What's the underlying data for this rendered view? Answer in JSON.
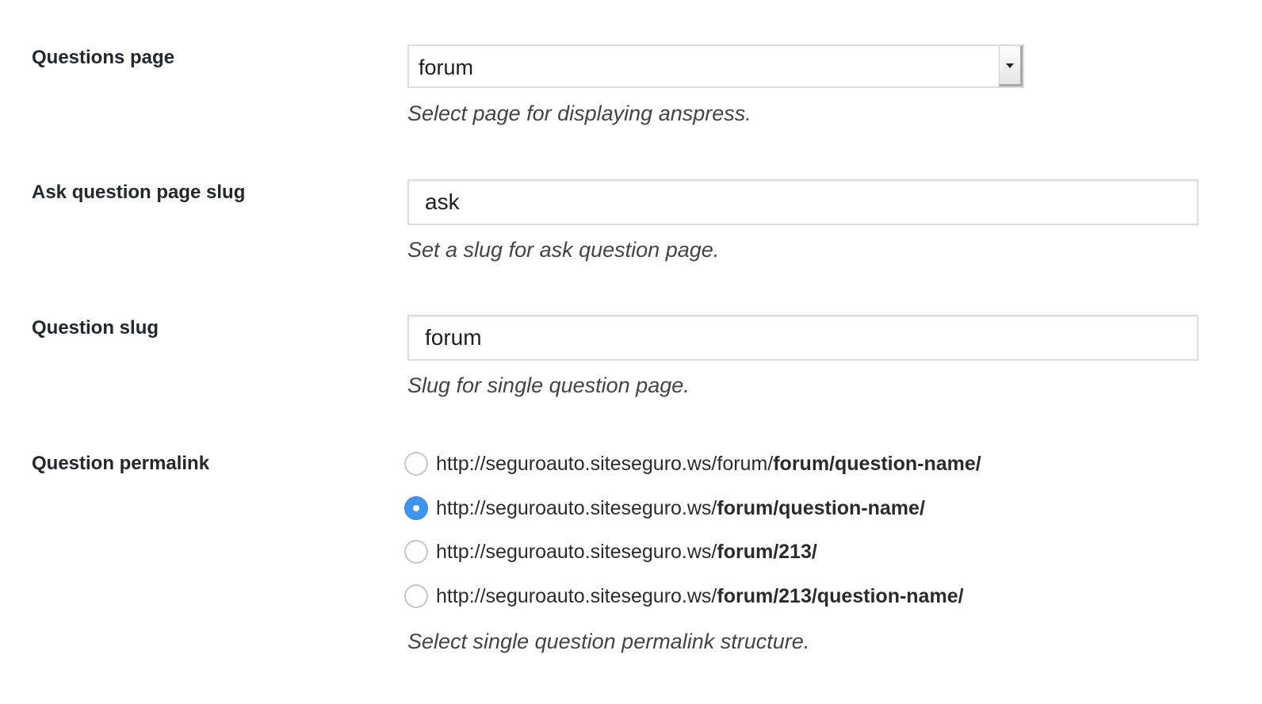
{
  "questions_page": {
    "label": "Questions page",
    "selected": "forum",
    "description": "Select page for displaying anspress."
  },
  "ask_slug": {
    "label": "Ask question page slug",
    "value": "ask",
    "description": "Set a slug for ask question page."
  },
  "question_slug": {
    "label": "Question slug",
    "value": "forum",
    "description": "Slug for single question page."
  },
  "permalink": {
    "label": "Question permalink",
    "description": "Select single question permalink structure.",
    "options": [
      {
        "base": "http://seguroauto.siteseguro.ws/forum/",
        "structure": "forum/question-name/",
        "checked": false
      },
      {
        "base": "http://seguroauto.siteseguro.ws/",
        "structure": "forum/question-name/",
        "checked": true
      },
      {
        "base": "http://seguroauto.siteseguro.ws/",
        "structure": "forum/213/",
        "checked": false
      },
      {
        "base": "http://seguroauto.siteseguro.ws/",
        "structure": "forum/213/question-name/",
        "checked": false
      }
    ]
  }
}
